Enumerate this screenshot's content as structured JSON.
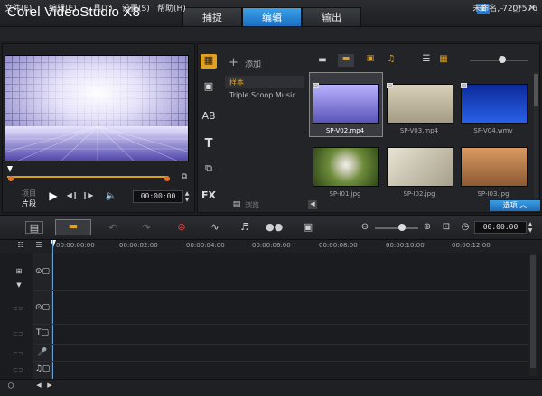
{
  "app": {
    "title": "Corel  VideoStudio X8",
    "tabs": [
      "捕捉",
      "编辑",
      "输出"
    ],
    "active_tab": 1,
    "project_info": "未命名, 720*576"
  },
  "menu": [
    "文件(F)",
    "编辑(E)",
    "工具(T)",
    "设置(S)",
    "帮助(H)"
  ],
  "preview": {
    "mode_project": "项目",
    "mode_clip": "片段",
    "timecode": "00:00:00"
  },
  "library": {
    "add_label": "添加",
    "folders": [
      "样本",
      "Triple Scoop Music"
    ],
    "browse_label": "浏览",
    "options_label": "选项",
    "items": [
      {
        "name": "SP-V02.mp4",
        "color": "#6a68c8"
      },
      {
        "name": "SP-V03.mp4",
        "color": "#b5ad96"
      },
      {
        "name": "SP-V04.wmv",
        "color": "#1a40c0"
      },
      {
        "name": "SP-I01.jpg",
        "color": "#6d8c3a"
      },
      {
        "name": "SP-I02.jpg",
        "color": "#c7c0a8"
      },
      {
        "name": "SP-I03.jpg",
        "color": "#b07a4a"
      }
    ]
  },
  "timeline": {
    "timecode": "00:00:00",
    "ruler": [
      "00:00:00:00",
      "00:00:02:00",
      "00:00:04:00",
      "00:00:06:00",
      "00:00:08:00",
      "00:00:10:00",
      "00:00:12:00"
    ]
  }
}
